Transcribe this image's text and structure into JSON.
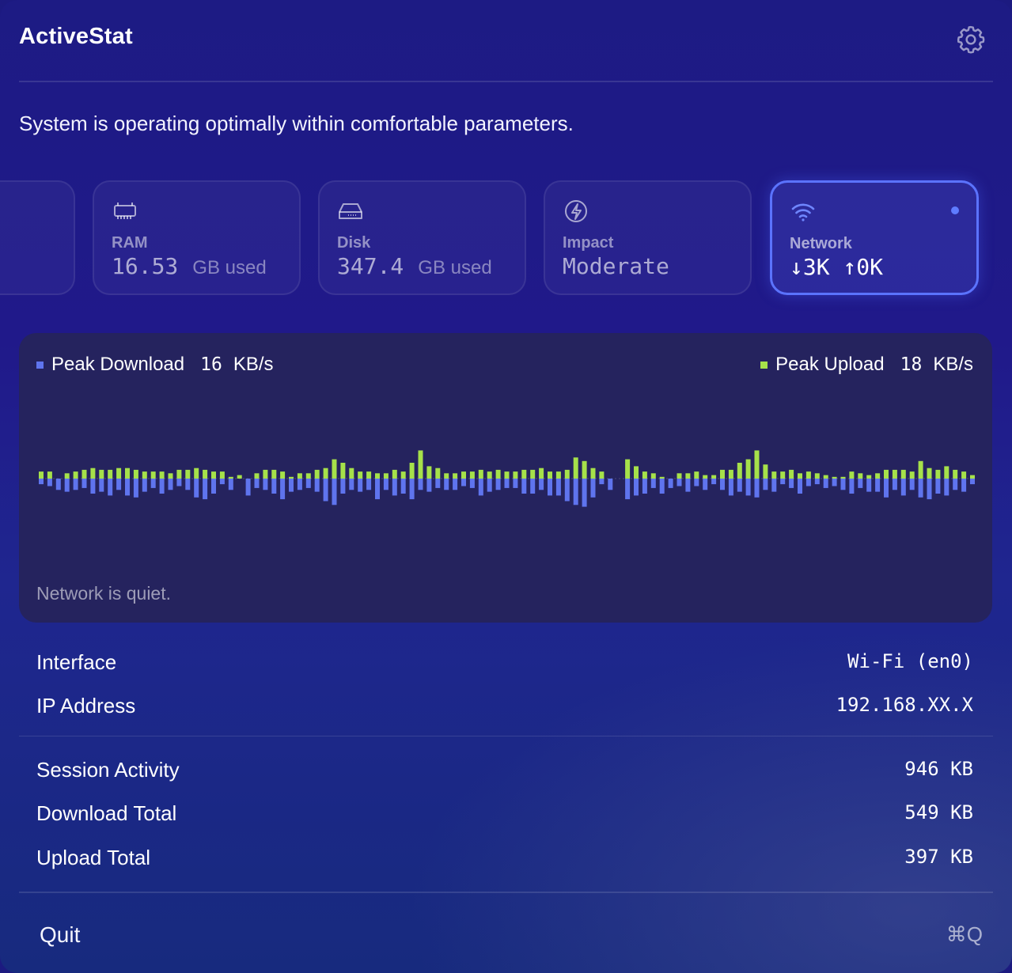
{
  "app": {
    "title": "ActiveStat"
  },
  "status_message": "System is operating optimally within comfortable parameters.",
  "cards": {
    "ram": {
      "label": "RAM",
      "value": "16.53",
      "unit": "GB used",
      "icon": "memory-chip-icon"
    },
    "disk": {
      "label": "Disk",
      "value": "347.4",
      "unit": "GB used",
      "icon": "hard-drive-icon"
    },
    "impact": {
      "label": "Impact",
      "value": "Moderate",
      "icon": "bolt-circle-icon"
    },
    "network": {
      "label": "Network",
      "value": "↓3K ↑0K",
      "icon": "wifi-icon",
      "selected": true
    }
  },
  "network_graph": {
    "peak_download_label": "Peak Download",
    "peak_download_value": "16",
    "peak_download_unit": "KB/s",
    "peak_upload_label": "Peak Upload",
    "peak_upload_value": "18",
    "peak_upload_unit": "KB/s",
    "quiet_message": "Network is quiet.",
    "download_color": "#5f74ee",
    "upload_color": "#a6e14a",
    "download_kbps": [
      3,
      4,
      6,
      7,
      6,
      5,
      8,
      7,
      9,
      6,
      9,
      10,
      7,
      5,
      8,
      6,
      4,
      6,
      10,
      11,
      8,
      3,
      6,
      0,
      9,
      5,
      6,
      8,
      11,
      7,
      6,
      5,
      7,
      12,
      14,
      8,
      6,
      7,
      6,
      11,
      6,
      9,
      8,
      11,
      6,
      7,
      5,
      6,
      6,
      4,
      5,
      9,
      7,
      6,
      5,
      5,
      8,
      8,
      6,
      9,
      9,
      12,
      14,
      15,
      10,
      3,
      6,
      0,
      11,
      9,
      8,
      5,
      8,
      5,
      4,
      7,
      4,
      6,
      3,
      6,
      9,
      7,
      9,
      10,
      6,
      7,
      3,
      5,
      8,
      4,
      3,
      5,
      4,
      6,
      8,
      5,
      7,
      7,
      10,
      6,
      9,
      6,
      10,
      11,
      8,
      9,
      6,
      7,
      3
    ],
    "upload_kbps": [
      4,
      4,
      0,
      3,
      4,
      5,
      6,
      5,
      5,
      6,
      6,
      5,
      4,
      4,
      4,
      3,
      5,
      5,
      6,
      5,
      4,
      4,
      1,
      2,
      0,
      3,
      5,
      5,
      4,
      1,
      3,
      3,
      5,
      6,
      11,
      9,
      6,
      4,
      4,
      3,
      3,
      5,
      4,
      9,
      16,
      7,
      6,
      3,
      3,
      4,
      4,
      5,
      4,
      5,
      4,
      4,
      5,
      5,
      6,
      4,
      4,
      5,
      12,
      10,
      6,
      4,
      0,
      0,
      11,
      7,
      4,
      3,
      1,
      0,
      3,
      3,
      4,
      2,
      2,
      5,
      5,
      9,
      11,
      16,
      8,
      4,
      4,
      5,
      3,
      4,
      3,
      2,
      1,
      1,
      4,
      3,
      2,
      3,
      5,
      5,
      5,
      4,
      10,
      6,
      5,
      7,
      5,
      4,
      2
    ]
  },
  "info": {
    "interface_label": "Interface",
    "interface_value": "Wi-Fi (en0)",
    "ip_label": "IP Address",
    "ip_value": "192.168.XX.X",
    "session_label": "Session Activity",
    "session_value": "946 KB",
    "download_total_label": "Download Total",
    "download_total_value": "549 KB",
    "upload_total_label": "Upload Total",
    "upload_total_value": "397 KB"
  },
  "footer": {
    "quit_label": "Quit",
    "quit_shortcut": "⌘Q"
  }
}
